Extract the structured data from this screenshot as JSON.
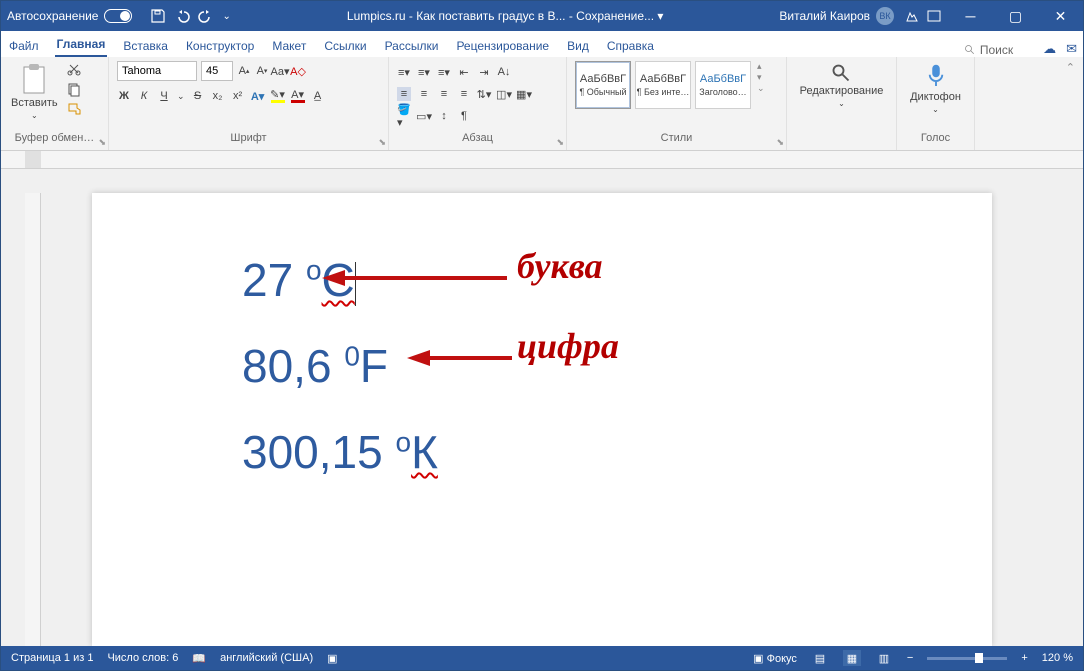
{
  "titlebar": {
    "autosave": "Автосохранение",
    "doc_title": "Lumpics.ru - Как поставить градус в B... - Сохранение... ▾",
    "user_name": "Виталий Каиров",
    "user_initials": "ВК"
  },
  "tabs": {
    "file": "Файл",
    "home": "Главная",
    "insert": "Вставка",
    "design": "Конструктор",
    "layout": "Макет",
    "references": "Ссылки",
    "mailings": "Рассылки",
    "review": "Рецензирование",
    "view": "Вид",
    "help": "Справка",
    "search": "Поиск"
  },
  "ribbon": {
    "clipboard": {
      "label": "Буфер обмен…",
      "paste": "Вставить"
    },
    "font": {
      "label": "Шрифт",
      "name": "Tahoma",
      "size": "45",
      "bold": "Ж",
      "italic": "К",
      "underline": "Ч",
      "strike": "S",
      "sub": "x₂",
      "sup": "x²",
      "font_a": "A"
    },
    "paragraph": {
      "label": "Абзац"
    },
    "styles": {
      "label": "Стили",
      "preview": "АаБбВвГ",
      "s1": "¶ Обычный",
      "s2": "¶ Без инте…",
      "s3": "Заголово…"
    },
    "editing": {
      "label": "Редактирование"
    },
    "voice": {
      "label": "Голос",
      "dictation": "Диктофон"
    }
  },
  "document": {
    "line1a": "27 ",
    "line1b": "о",
    "line1c": "С",
    "line2a": "80,6 ",
    "line2b": "0",
    "line2c": "F",
    "line3a": "300,15 ",
    "line3b": "о",
    "line3c": "К"
  },
  "annotations": {
    "letter": "буква",
    "digit": "цифра"
  },
  "status": {
    "page": "Страница 1 из 1",
    "words": "Число слов: 6",
    "lang": "английский (США)",
    "focus": "Фокус",
    "zoom": "120 %"
  }
}
